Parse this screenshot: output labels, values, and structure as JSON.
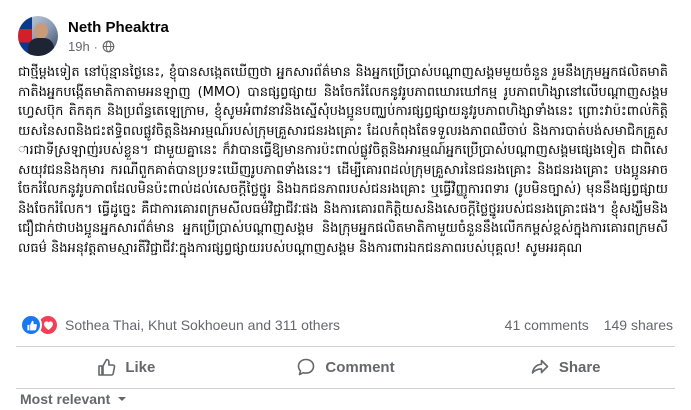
{
  "post": {
    "author": "Neth Pheaktra",
    "time": "19h",
    "separator": "·",
    "privacy_icon": "globe-icon",
    "body": "ជាថ្មីម្តងទៀត នៅប៉ុន្មានថ្ងៃនេះ, ខ្ញុំបានសង្កេតឃើញថា អ្នកសារព័ត៌មាន និងអ្នកប្រើប្រាស់បណ្តាញសង្គមមួយចំនួន រួមនឹងក្រុមអ្នកផលិតមាតិកាតិងអ្នកបង្កើតមាតិកាតាមអនឡាញ (MMO) បានផ្សព្វផ្សាយ និងចែករំលែកនូវរូបភាពឃោរឃៅកម្ម រូបភាពហិង្សានៅលើបណ្តាញសង្គមហ្វេសប៊ុក តិកតុក និងប្រព័ន្ធតេឡេក្រាម, ខ្ញុំសូមអំពាវនាវនិងស្នើសុំបងប្អូនបញ្ឈប់ការផ្សព្វផ្សាយនូវរូបភាពហិង្សាទាំងនេះ ព្រោះវាប៉ះពាល់កិត្តិយសនៃសពនិងជះឥទ្ធិពលផ្លូវចិត្តនិងអារម្មណ៍របស់ក្រុមគ្រួសារជនរងគ្រោះ ដែលកំពុងតែទទួលរងភាពឈឺចាប់ និងការបាត់បង់សមាជិកគ្រួសារជាទីស្រឡាញ់របស់ខ្លួន។ ជាមួយគ្នានេះ ក៏វាបានធ្វើឱ្យមានការប៉ះពាល់ផ្លូវចិត្តនិងអារម្មណ៍អ្នកប្រើប្រាស់បណ្តាញសង្គមផ្សេងទៀត ជាពិសេសយុវជននិងកុមារ ករណីពួកគាត់បានប្រទះឃើញរូបភាពទាំងនេះ។ ដើម្បីគោរពដល់ក្រុមគ្រួសារនៃជនរងគ្រោះ និងជនរងគ្រោះ បងប្អូនអាចចែករំលែកនូវរូបភាពដែលមិនប៉ះពាល់ដល់សេចក្តីថ្លៃថ្នូរ និងឯកជនភាពរបស់ជនរងគ្រោះ ឬធ្វើវិញ្ញូការពទារ (រូបមិនច្បាស់) មុននឹងផ្សព្វផ្សាយ និងចែករំលែក។ ធ្វើដូច្នេះ គឺជាការគោរពក្រមសីលធម៌វិជ្ជាជីវៈផង និងការគោរពកិត្តិយសនិងសេចក្តីថ្លៃថ្នូររបស់ជនរងគ្រោះផង។ ខ្ញុំសង្ឃឹមនិងជឿជាក់ថាបងប្អូនអ្នកសារព័ត៌មាន អ្នកប្រើប្រាស់បណ្តាញសង្គម និងក្រុមអ្នកផលិតមាតិកាមួយចំនួននឹងលើកកម្ពស់ខ្ពស់ក្នុងការគោរពក្រមសីលធម៌ និងអនុវត្តតាមស្មារតីវិជ្ជាជីវៈក្នុងការផ្សព្វផ្សាយរបស់បណ្តាញសង្គម និងការពារឯកជនភាពរបស់បុគ្គល! សូមអរគុណ",
    "reactors": "Sothea Thai, Khut Sokhoeun and 311 others",
    "comments_count": "41 comments",
    "shares_count": "149 shares",
    "actions": {
      "like": "Like",
      "comment": "Comment",
      "share": "Share"
    },
    "sort_label": "Most relevant",
    "colors": {
      "like_blue": "#1877f2",
      "love_red": "#f33e58",
      "muted": "#65676b",
      "divider": "#ced0d4"
    }
  }
}
